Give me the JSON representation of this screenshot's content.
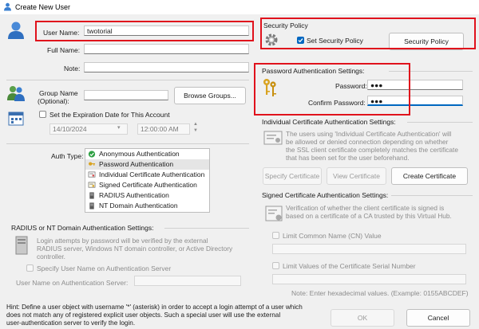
{
  "window": {
    "title": "Create New User"
  },
  "user": {
    "user_name_label": "User Name:",
    "user_name_value": "twotorial",
    "full_name_label": "Full Name:",
    "full_name_value": "",
    "note_label": "Note:",
    "note_value": "",
    "group_label_1": "Group Name",
    "group_label_2": "(Optional):",
    "group_value": "",
    "browse_groups": "Browse Groups...",
    "expiration_label": "Set the Expiration Date for This Account",
    "expiration_checked": false,
    "date_value": "14/10/2024",
    "time_value": "12:00:00 AM"
  },
  "auth": {
    "label": "Auth Type:",
    "items": [
      {
        "label": "Anonymous Authentication",
        "icon": "green-check-icon",
        "selected": false
      },
      {
        "label": "Password Authentication",
        "icon": "key-icon",
        "selected": true
      },
      {
        "label": "Individual Certificate Authentication",
        "icon": "certificate-icon",
        "selected": false
      },
      {
        "label": "Signed Certificate Authentication",
        "icon": "signed-certificate-icon",
        "selected": false
      },
      {
        "label": "RADIUS Authentication",
        "icon": "server-icon",
        "selected": false
      },
      {
        "label": "NT Domain Authentication",
        "icon": "server-icon",
        "selected": false
      }
    ]
  },
  "radius": {
    "title": "RADIUS or NT Domain Authentication Settings:",
    "desc": [
      "Login attempts by password will be verified by the external",
      "RADIUS server, Windows NT domain controller, or Active Directory",
      "controller."
    ],
    "specify_label": "Specify User Name on Authentication Server",
    "username_label": "User Name on Authentication Server:",
    "username_value": ""
  },
  "security": {
    "title": "Security Policy",
    "set_label": "Set Security Policy",
    "set_checked": true,
    "button": "Security Policy"
  },
  "password": {
    "title": "Password Authentication Settings:",
    "password_label": "Password:",
    "password_value": "●●●",
    "confirm_label": "Confirm Password:",
    "confirm_value": "●●●"
  },
  "individual_cert": {
    "title": "Individual Certificate Authentication Settings:",
    "desc": [
      "The users using 'Individual Certificate Authentication' will",
      "be allowed or denied connection depending on whether",
      "the SSL client certificate completely matches the certificate",
      "that has been set for the user beforehand."
    ],
    "specify_button": "Specify Certificate",
    "view_button": "View Certificate",
    "create_button": "Create Certificate"
  },
  "signed_cert": {
    "title": "Signed Certificate Authentication Settings:",
    "desc": [
      "Verification of whether the client certificate is signed is",
      "based on a certificate of a CA trusted by this Virtual Hub."
    ],
    "limit_cn_label": "Limit Common Name (CN) Value",
    "limit_cn_value": "",
    "limit_serial_label": "Limit Values of the Certificate Serial Number",
    "limit_serial_value": "",
    "note": "Note: Enter hexadecimal values. (Example: 0155ABCDEF)"
  },
  "hint": [
    "Hint: Define a user object with username '*' (asterisk) in order to accept a login attempt of a user which",
    "does not match any of registered explicit user objects. Such a special user will use the external",
    "user-authentication server to verify the login."
  ],
  "footer": {
    "ok": "OK",
    "cancel": "Cancel"
  },
  "colors": {
    "highlight": "#e0121c",
    "accent": "#0067c0"
  }
}
